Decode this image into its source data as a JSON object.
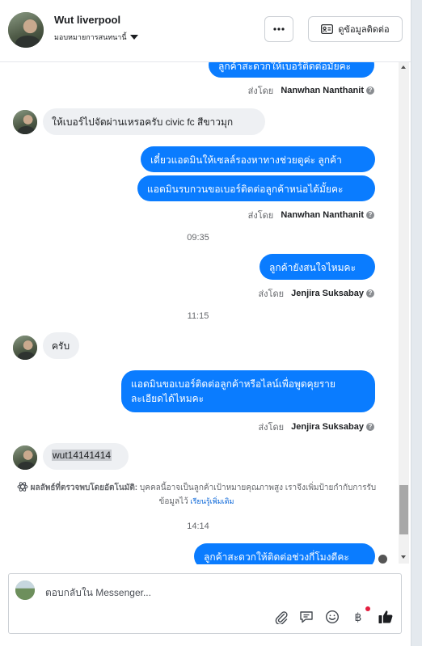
{
  "header": {
    "name": "Wut liverpool",
    "assign_label": "มอบหมายการสนทนานี้",
    "contact_button": "ดูข้อมูลติดต่อ"
  },
  "messages": {
    "top_partial": "ลูกค้าสะดวกให้เบอร์ติดต่อมั้ยคะ",
    "m1_sent_prefix": "ส่งโดย",
    "m1_sent_name": "Nanwhan Nanthanit",
    "in1": "ให้เบอร์ไปจัดผ่านเหรอครับ civic fc สีขาวมุก",
    "out2": "เดี๋ยวแอดมินให้เซลล์รองหาทางช่วยดูค่ะ ลูกค้า",
    "out3": "แอดมินรบกวนขอเบอร์ติดต่อลูกค้าหน่อได้มั้ยคะ",
    "m2_sent_prefix": "ส่งโดย",
    "m2_sent_name": "Nanwhan Nanthanit",
    "time1": "09:35",
    "out4": "ลูกค้ายังสนใจไหมคะ",
    "m3_sent_prefix": "ส่งโดย",
    "m3_sent_name": "Jenjira Suksabay",
    "time2": "11:15",
    "in2": "ครับ",
    "out5_line1": "แอดมินขอเบอร์ติดต่อลูกค้าหรือไลน์เพื่อพูดคุยราย",
    "out5_line2": "ละเอียดได้ไหมคะ",
    "m4_sent_prefix": "ส่งโดย",
    "m4_sent_name": "Jenjira Suksabay",
    "in3": "wut14141414",
    "ai_title": "ผลลัพธ์ที่ตรวจพบโดยอัตโนมัติ:",
    "ai_text": "บุคคลนี้อาจเป็นลูกค้าเป้าหมายคุณภาพสูง เราจึงเพิ่มป้ายกำกับการรับข้อมูลไว้",
    "ai_link": "เรียนรู้เพิ่มเติม",
    "time3": "14:14",
    "out6": "ลูกค้าสะดวกให้ติดต่อช่วงกี่โมงดีคะ"
  },
  "composer": {
    "placeholder": "ตอบกลับใน Messenger..."
  },
  "colors": {
    "accent": "#0a7cff",
    "incoming": "#eef0f3",
    "link": "#0a66d8"
  },
  "icons": [
    "more-icon",
    "contact-card-icon",
    "caret-down-icon",
    "help-icon",
    "ai-icon",
    "attach-icon",
    "saved-reply-icon",
    "emoji-icon",
    "baht-icon",
    "like-icon"
  ]
}
